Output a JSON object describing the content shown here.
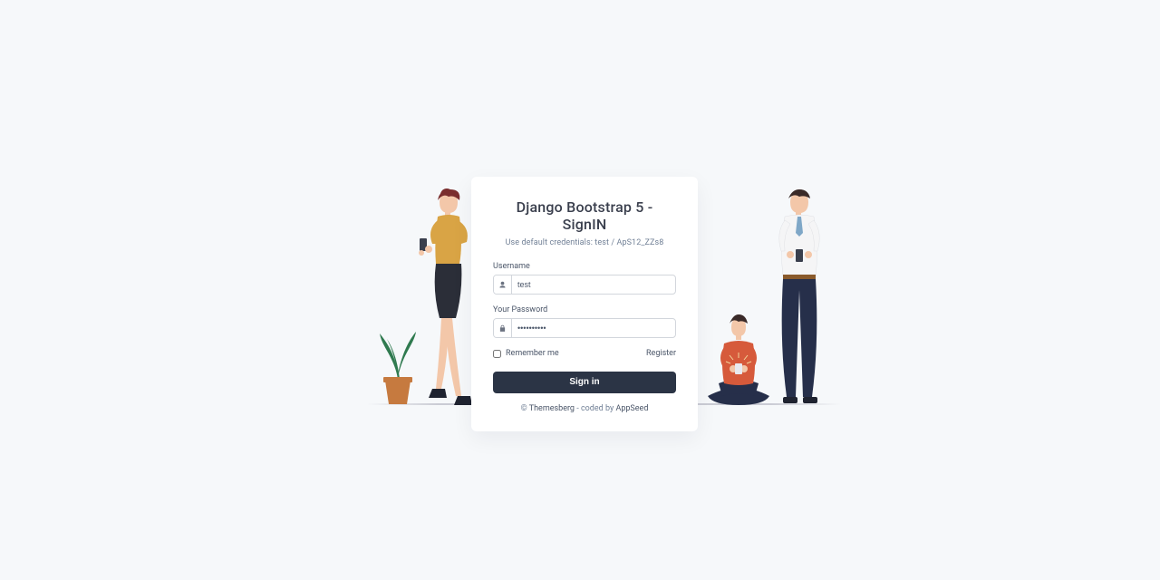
{
  "form": {
    "title": "Django Bootstrap 5 - SignIN",
    "subtitle": "Use default credentials: test / ApS12_ZZs8",
    "username_label": "Username",
    "username_value": "test",
    "password_label": "Your Password",
    "password_value": "••••••••••",
    "remember_label": "Remember me",
    "register_label": "Register",
    "submit_label": "Sign in"
  },
  "footer": {
    "copyright_prefix": "© ",
    "brand": "Themesberg",
    "separator": " - coded by ",
    "coder": "AppSeed"
  }
}
